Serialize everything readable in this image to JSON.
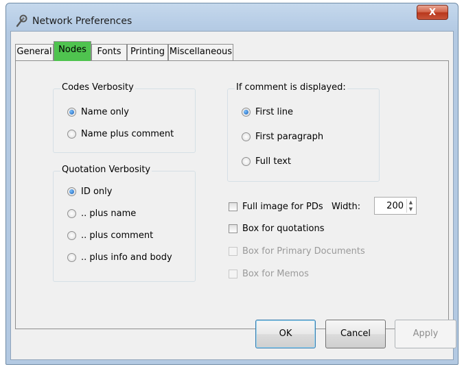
{
  "window": {
    "title": "Network Preferences",
    "close_label": "X"
  },
  "tabs": [
    {
      "label": "General",
      "active": false
    },
    {
      "label": "Nodes",
      "active": true
    },
    {
      "label": "Fonts",
      "active": false
    },
    {
      "label": "Printing",
      "active": false
    },
    {
      "label": "Miscellaneous",
      "active": false
    }
  ],
  "codes_verbosity": {
    "title": "Codes Verbosity",
    "options": [
      {
        "label": "Name only",
        "selected": true
      },
      {
        "label": "Name plus comment",
        "selected": false
      }
    ]
  },
  "quotation_verbosity": {
    "title": "Quotation Verbosity",
    "options": [
      {
        "label": "ID only",
        "selected": true
      },
      {
        "label": ".. plus name",
        "selected": false
      },
      {
        "label": ".. plus comment",
        "selected": false
      },
      {
        "label": ".. plus info and body",
        "selected": false
      }
    ]
  },
  "comment_display": {
    "title": "If comment is displayed:",
    "options": [
      {
        "label": "First line",
        "selected": true
      },
      {
        "label": "First paragraph",
        "selected": false
      },
      {
        "label": "Full text",
        "selected": false
      }
    ]
  },
  "checkboxes": [
    {
      "label": "Full image for PDs",
      "checked": false,
      "enabled": true
    },
    {
      "label": "Box for quotations",
      "checked": false,
      "enabled": true
    },
    {
      "label": "Box for Primary Documents",
      "checked": false,
      "enabled": false
    },
    {
      "label": "Box for Memos",
      "checked": false,
      "enabled": false
    }
  ],
  "width": {
    "label": "Width:",
    "value": "200"
  },
  "buttons": {
    "ok": "OK",
    "cancel": "Cancel",
    "apply": "Apply"
  },
  "colors": {
    "active_tab": "#4fc34f",
    "close_button": "#c8553a",
    "title_bar": "#b7cde6"
  }
}
